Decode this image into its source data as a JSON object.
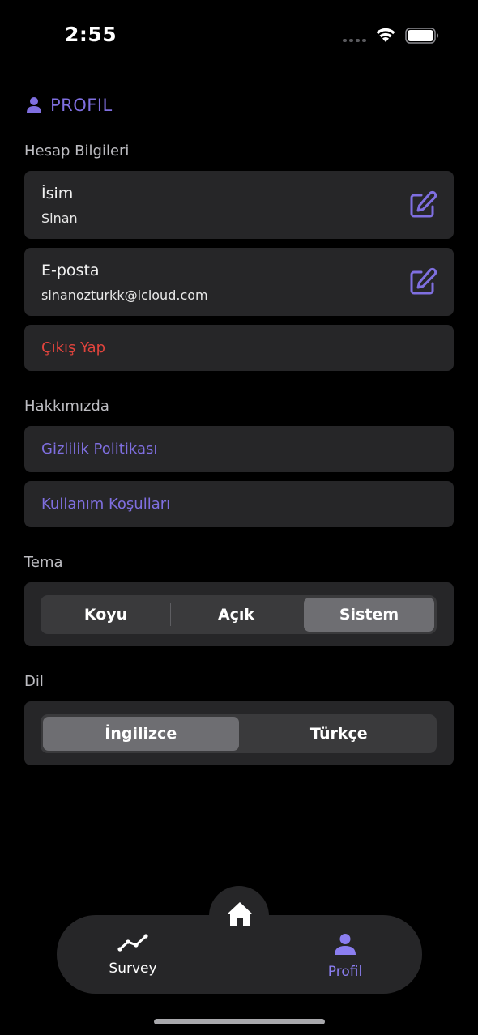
{
  "status_bar": {
    "time": "2:55"
  },
  "header": {
    "icon": "person-icon",
    "title": "PROFIL"
  },
  "account": {
    "section_title": "Hesap Bilgileri",
    "name_label": "İsim",
    "name_value": "Sinan",
    "email_label": "E-posta",
    "email_value": "sinanozturkk@icloud.com",
    "logout_label": "Çıkış Yap"
  },
  "about": {
    "section_title": "Hakkımızda",
    "privacy_label": "Gizlilik Politikası",
    "terms_label": "Kullanım Koşulları"
  },
  "theme": {
    "section_title": "Tema",
    "options": [
      "Koyu",
      "Açık",
      "Sistem"
    ],
    "selected": "Sistem"
  },
  "language": {
    "section_title": "Dil",
    "options": [
      "İngilizce",
      "Türkçe"
    ],
    "selected": "İngilizce"
  },
  "tab_bar": {
    "survey_label": "Survey",
    "profile_label": "Profil",
    "active_tab": "Profil"
  },
  "colors": {
    "accent": "#7f6fe0",
    "danger": "#e2443d",
    "card": "#262628",
    "background": "#000000"
  }
}
